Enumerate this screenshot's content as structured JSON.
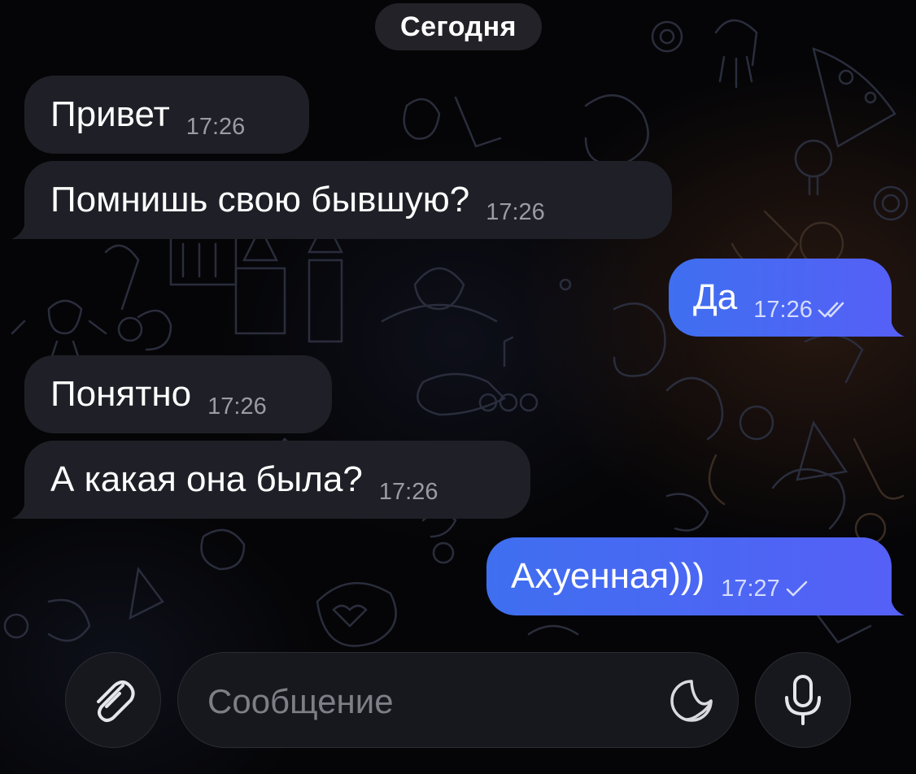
{
  "chat": {
    "date_label": "Сегодня",
    "messages": [
      {
        "direction": "incoming",
        "text": "Привет",
        "time": "17:26"
      },
      {
        "direction": "incoming",
        "text": "Помнишь свою бывшую?",
        "time": "17:26"
      },
      {
        "direction": "outgoing",
        "text": "Да",
        "time": "17:26",
        "status": "read"
      },
      {
        "direction": "incoming",
        "text": "Понятно",
        "time": "17:26"
      },
      {
        "direction": "incoming",
        "text": "А какая она была?",
        "time": "17:26"
      },
      {
        "direction": "outgoing",
        "text": "Ахуенная)))",
        "time": "17:27",
        "status": "sent"
      }
    ]
  },
  "composer": {
    "placeholder": "Сообщение",
    "attach_icon": "paperclip-icon",
    "sticker_icon": "sticker-icon",
    "voice_icon": "microphone-icon"
  },
  "colors": {
    "incoming_bubble": "#1f2027",
    "outgoing_bubble": "#4a68f4",
    "background": "#050507"
  }
}
